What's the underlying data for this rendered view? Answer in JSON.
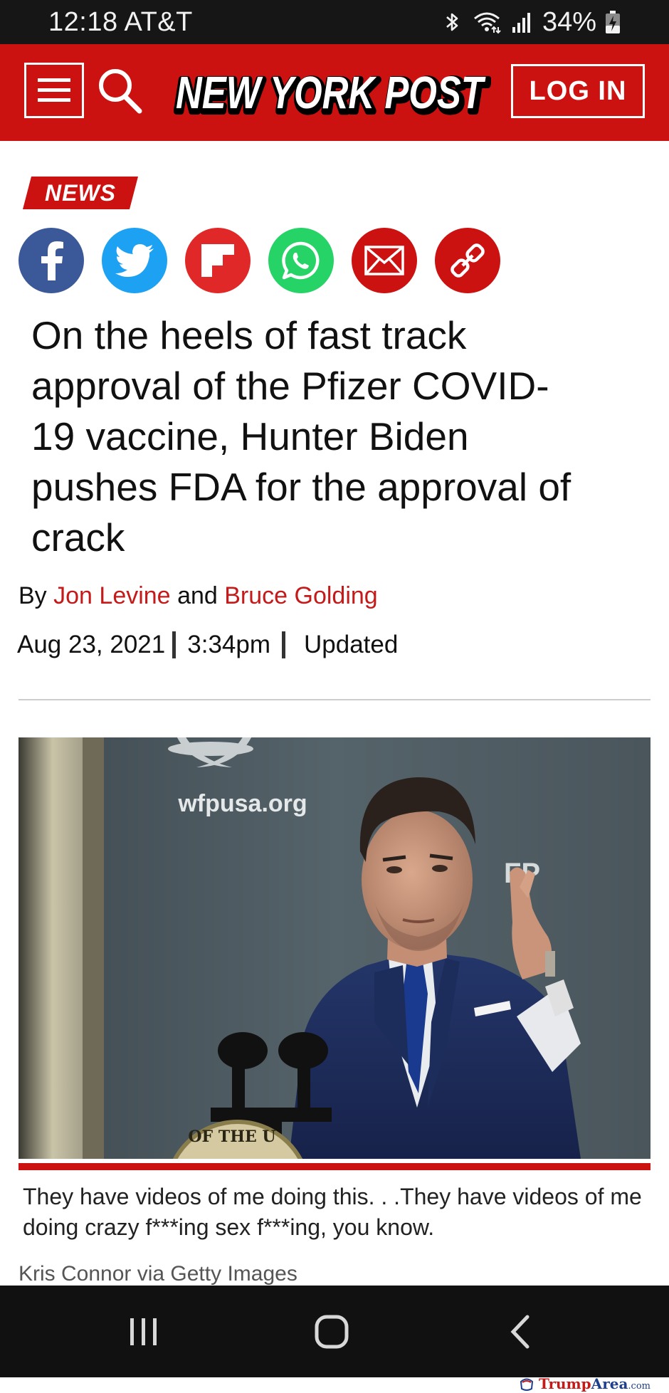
{
  "status_bar": {
    "time_carrier": "12:18 AT&T",
    "battery": "34%",
    "icons": [
      "bluetooth-icon",
      "wifi-icon",
      "signal-icon",
      "battery-charging-icon"
    ]
  },
  "header": {
    "logo_text": "NEW YORK POST",
    "login_label": "LOG IN",
    "brand_color": "#cc1111"
  },
  "article": {
    "section": "NEWS",
    "share_buttons": [
      {
        "name": "facebook-icon",
        "color": "#3b5998"
      },
      {
        "name": "twitter-icon",
        "color": "#1da1f2"
      },
      {
        "name": "flipboard-icon",
        "color": "#e12828"
      },
      {
        "name": "whatsapp-icon",
        "color": "#25d366"
      },
      {
        "name": "email-icon",
        "color": "#cc1111"
      },
      {
        "name": "link-icon",
        "color": "#cc1111"
      }
    ],
    "headline": "On the heels of fast track approval of the Pfizer COVID-19 vaccine, Hunter Biden pushes FDA for the approval of crack",
    "byline": {
      "prefix": "By",
      "author1": "Jon Levine",
      "conjunction": "and",
      "author2": "Bruce Golding"
    },
    "date": "Aug 23, 2021",
    "time": "3:34pm",
    "updated": "Updated",
    "photo": {
      "backdrop_text": "wfpusa.org",
      "backdrop_text_2": "FP",
      "podium_text": "OF THE U"
    },
    "caption": "They have videos of me doing this. . .They have videos of me doing crazy f***ing sex f***ing, you know.",
    "credit": "Kris Connor via Getty Images"
  },
  "nav_bar": {
    "buttons": [
      "recent-apps-icon",
      "home-icon",
      "back-icon"
    ]
  },
  "watermark": {
    "part1": "Trump",
    "part2": "Area",
    "part3": ".com"
  }
}
